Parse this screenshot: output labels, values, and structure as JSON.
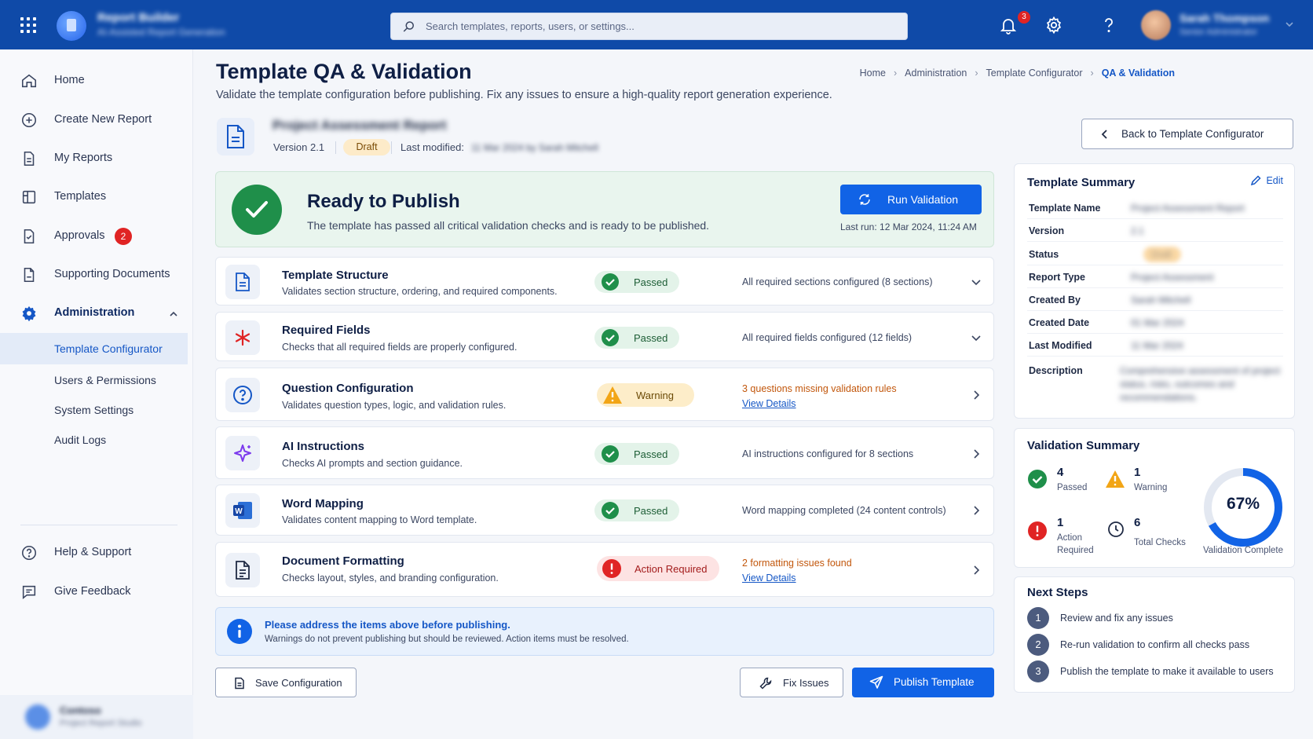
{
  "header": {
    "app_name": "Report Builder",
    "app_subtitle": "AI-Assisted Report Generation",
    "search_placeholder": "Search templates, reports, users, or settings...",
    "notification_count": "3",
    "user_name": "Sarah Thompson",
    "user_role": "Senior Administrator"
  },
  "sidebar": {
    "items": [
      {
        "label": "Home",
        "icon": "home-icon"
      },
      {
        "label": "Create New Report",
        "icon": "plus-circle-icon"
      },
      {
        "label": "My Reports",
        "icon": "document-icon"
      },
      {
        "label": "Templates",
        "icon": "layout-icon"
      },
      {
        "label": "Approvals",
        "icon": "check-square-icon",
        "badge": "2"
      },
      {
        "label": "Supporting Documents",
        "icon": "file-icon"
      },
      {
        "label": "Administration",
        "icon": "gear-icon"
      }
    ],
    "admin_subitems": [
      {
        "label": "Template Configurator"
      },
      {
        "label": "Users & Permissions"
      },
      {
        "label": "System Settings"
      },
      {
        "label": "Audit Logs"
      }
    ],
    "footer_items": [
      {
        "label": "Help & Support",
        "icon": "help-circle-icon"
      },
      {
        "label": "Give Feedback",
        "icon": "feedback-icon"
      }
    ],
    "org_name": "Contoso",
    "org_sub": "Project Report Studio"
  },
  "page": {
    "title": "Template QA & Validation",
    "subtitle": "Validate the template configuration before publishing. Fix any issues to ensure a high-quality report generation experience.",
    "breadcrumb": [
      "Home",
      "Administration",
      "Template Configurator",
      "QA & Validation"
    ]
  },
  "template": {
    "name": "Project Assessment Report",
    "version": "Version 2.1",
    "status": "Draft",
    "modified_label": "Last modified:",
    "modified_value": "11 Mar 2024 by Sarah Mitchell"
  },
  "back_button": "Back to Template Configurator",
  "ready": {
    "title": "Ready to Publish",
    "description": "The template has passed all critical validation checks and is ready to be published.",
    "run_button": "Run Validation",
    "last_run": "Last run: 12 Mar 2024, 11:24 AM"
  },
  "checks": [
    {
      "title": "Template Structure",
      "desc": "Validates section structure, ordering, and required components.",
      "status": "Passed",
      "detail": "All required sections configured (8 sections)",
      "icon": "document-icon"
    },
    {
      "title": "Required Fields",
      "desc": "Checks that all required fields are properly configured.",
      "status": "Passed",
      "detail": "All required fields configured (12 fields)",
      "icon": "asterisk-icon"
    },
    {
      "title": "Question Configuration",
      "desc": "Validates question types, logic, and validation rules.",
      "status": "Warning",
      "detail": "3 questions missing validation rules",
      "link": "View Details",
      "icon": "question-icon"
    },
    {
      "title": "AI Instructions",
      "desc": "Checks AI prompts and section guidance.",
      "status": "Passed",
      "detail": "AI instructions configured for 8 sections",
      "icon": "sparkle-icon"
    },
    {
      "title": "Word Mapping",
      "desc": "Validates content mapping to Word template.",
      "status": "Passed",
      "detail": "Word mapping completed (24 content controls)",
      "icon": "word-icon"
    },
    {
      "title": "Document Formatting",
      "desc": "Checks layout, styles, and branding configuration.",
      "status": "Action Required",
      "detail": "2 formatting issues found",
      "link": "View Details",
      "icon": "format-icon"
    }
  ],
  "info": {
    "title": "Please address the items above before publishing.",
    "desc": "Warnings do not prevent publishing but should be reviewed. Action items must be resolved."
  },
  "actions": {
    "save": "Save Configuration",
    "fix": "Fix Issues",
    "publish": "Publish Template"
  },
  "summary": {
    "title": "Template Summary",
    "edit": "Edit",
    "rows": [
      {
        "label": "Template Name",
        "value": "Project Assessment Report"
      },
      {
        "label": "Version",
        "value": "2.1"
      },
      {
        "label": "Status",
        "value": "Draft"
      },
      {
        "label": "Report Type",
        "value": "Project Assessment"
      },
      {
        "label": "Created By",
        "value": "Sarah Mitchell"
      },
      {
        "label": "Created Date",
        "value": "01 Mar 2024"
      },
      {
        "label": "Last Modified",
        "value": "11 Mar 2024"
      }
    ],
    "description_label": "Description",
    "description_value": "Comprehensive assessment of project status, risks, outcomes and recommendations."
  },
  "validation_summary": {
    "title": "Validation Summary",
    "passed": {
      "num": "4",
      "label": "Passed"
    },
    "warning": {
      "num": "1",
      "label": "Warning"
    },
    "action": {
      "num": "1",
      "label": "Action Required"
    },
    "total": {
      "num": "6",
      "label": "Total Checks"
    },
    "percent": "67%",
    "percent_value": 0.67,
    "complete_label": "Validation Complete"
  },
  "next_steps": {
    "title": "Next Steps",
    "steps": [
      {
        "num": "1",
        "label": "Review and fix any issues"
      },
      {
        "num": "2",
        "label": "Re-run validation to confirm all checks pass"
      },
      {
        "num": "3",
        "label": "Publish the template to make it available to users"
      }
    ]
  },
  "colors": {
    "brand": "#0f4aa8",
    "primary": "#1163e6",
    "success": "#1f8f4a",
    "warning": "#f2a516",
    "danger": "#e02424"
  }
}
